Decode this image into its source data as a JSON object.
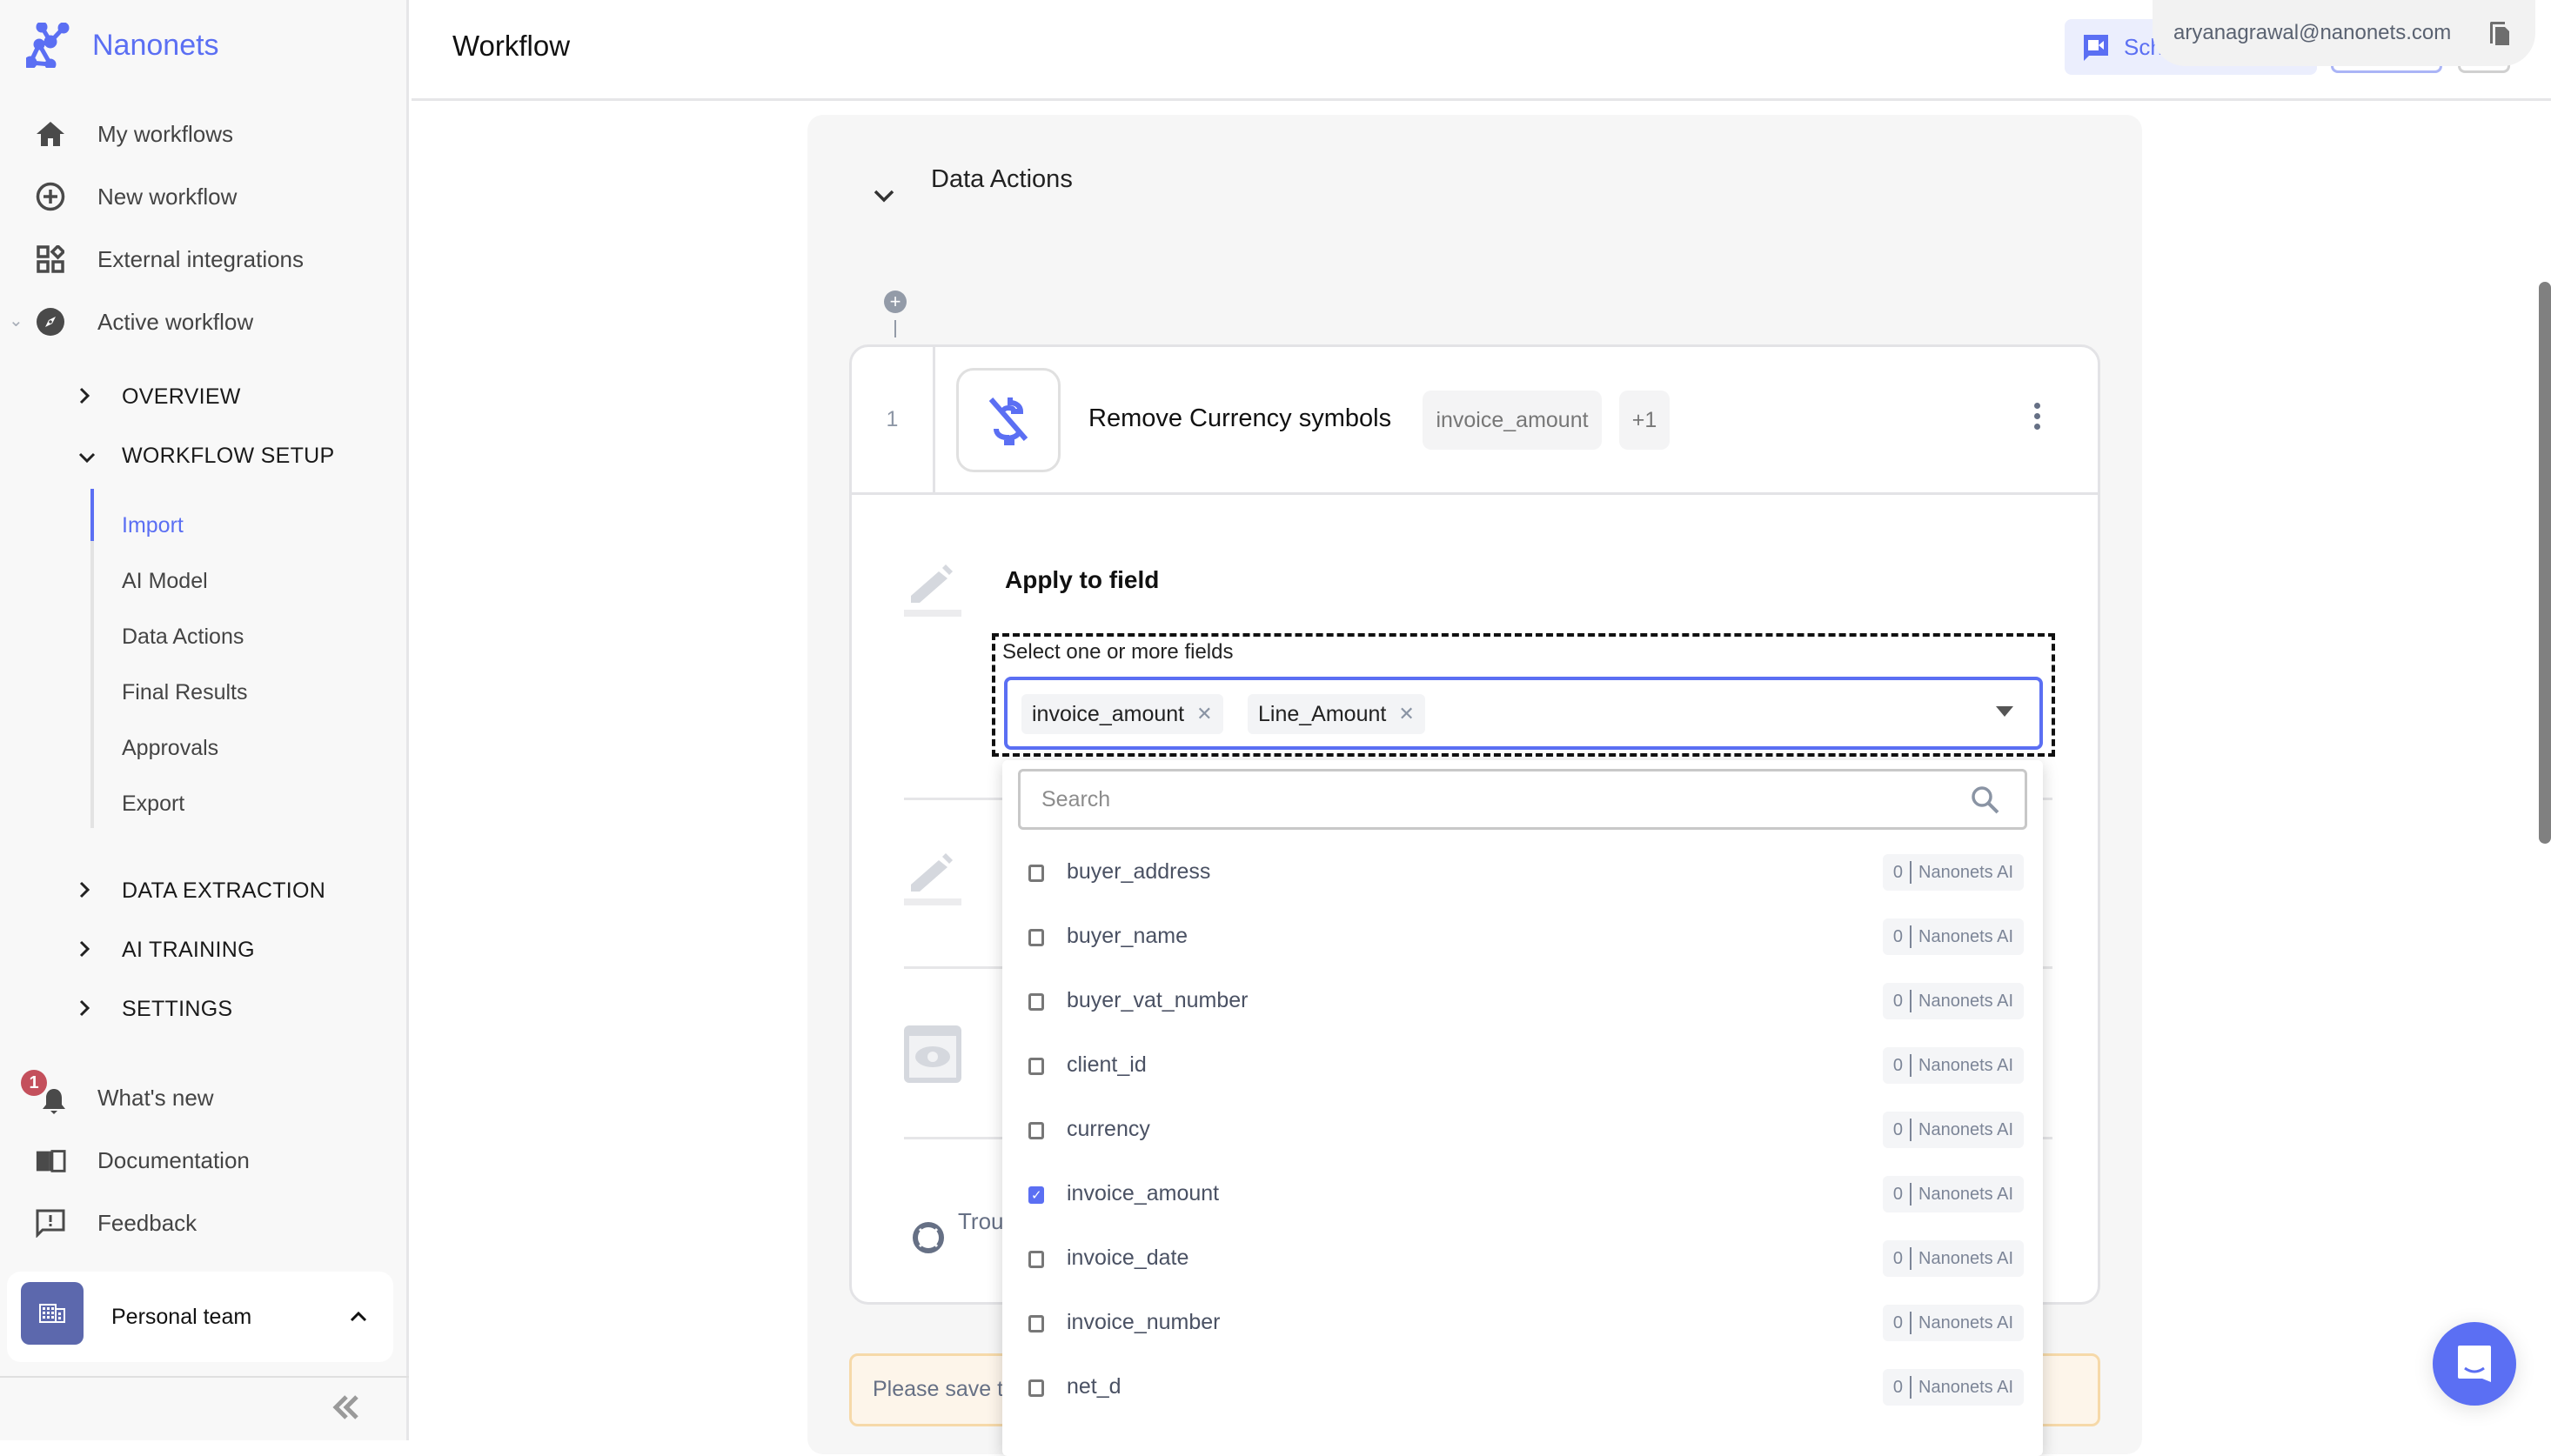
{
  "brand": {
    "name": "Nanonets",
    "color": "#5b6ff3"
  },
  "header": {
    "title": "Workflow",
    "schedule_button_label": "Sch",
    "email_tooltip": "aryanagrawal@nanonets.com"
  },
  "sidebar": {
    "items": [
      {
        "label": "My workflows",
        "icon": "home-icon"
      },
      {
        "label": "New workflow",
        "icon": "plus-circle-icon"
      },
      {
        "label": "External integrations",
        "icon": "integrations-icon"
      },
      {
        "label": "Active workflow",
        "icon": "compass-icon"
      }
    ],
    "sections": [
      {
        "label": "OVERVIEW",
        "expanded": false
      },
      {
        "label": "WORKFLOW SETUP",
        "expanded": true
      },
      {
        "label": "DATA EXTRACTION",
        "expanded": false
      },
      {
        "label": "AI TRAINING",
        "expanded": false
      },
      {
        "label": "SETTINGS",
        "expanded": false
      }
    ],
    "setup_items": [
      {
        "label": "Import",
        "active": true
      },
      {
        "label": "AI Model",
        "active": false
      },
      {
        "label": "Data Actions",
        "active": false
      },
      {
        "label": "Final Results",
        "active": false
      },
      {
        "label": "Approvals",
        "active": false
      },
      {
        "label": "Export",
        "active": false
      }
    ],
    "footer_items": [
      {
        "label": "What's new",
        "icon": "bell-icon",
        "badge": "1"
      },
      {
        "label": "Documentation",
        "icon": "book-icon"
      },
      {
        "label": "Feedback",
        "icon": "feedback-icon"
      }
    ],
    "team": {
      "name": "Personal team"
    }
  },
  "main": {
    "section_title": "Data Actions",
    "step": {
      "number": "1",
      "title": "Remove Currency symbols",
      "chips": [
        "invoice_amount",
        "+1"
      ]
    },
    "apply_to_field": {
      "title": "Apply to field",
      "select_label": "Select one or more fields",
      "selected_tags": [
        "invoice_amount",
        "Line_Amount"
      ]
    },
    "troubleshoot_text": "Trou",
    "notice_text": "Please save t"
  },
  "dropdown": {
    "search_placeholder": "Search",
    "options": [
      {
        "name": "buyer_address",
        "checked": false,
        "count": "0",
        "source": "Nanonets AI"
      },
      {
        "name": "buyer_name",
        "checked": false,
        "count": "0",
        "source": "Nanonets AI"
      },
      {
        "name": "buyer_vat_number",
        "checked": false,
        "count": "0",
        "source": "Nanonets AI"
      },
      {
        "name": "client_id",
        "checked": false,
        "count": "0",
        "source": "Nanonets AI"
      },
      {
        "name": "currency",
        "checked": false,
        "count": "0",
        "source": "Nanonets AI"
      },
      {
        "name": "invoice_amount",
        "checked": true,
        "count": "0",
        "source": "Nanonets AI"
      },
      {
        "name": "invoice_date",
        "checked": false,
        "count": "0",
        "source": "Nanonets AI"
      },
      {
        "name": "invoice_number",
        "checked": false,
        "count": "0",
        "source": "Nanonets AI"
      },
      {
        "name": "net_d",
        "checked": false,
        "count": "0",
        "source": "Nanonets AI"
      }
    ]
  }
}
